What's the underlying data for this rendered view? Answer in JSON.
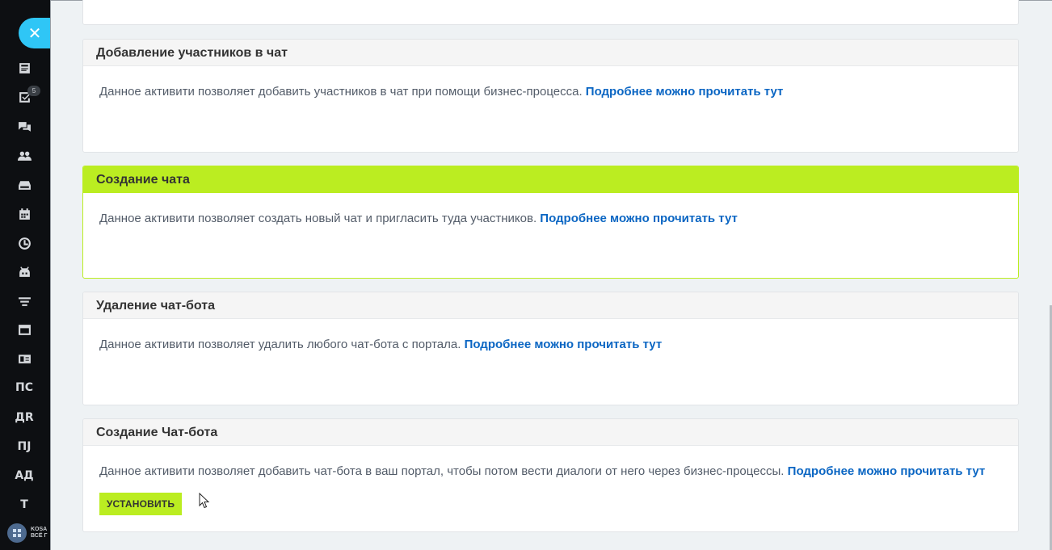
{
  "sidebar": {
    "close_icon": "✕",
    "badge_count": "5",
    "icons": [
      "feed-icon",
      "tasks-icon",
      "chat-icon",
      "users-icon",
      "drive-icon",
      "calendar-icon",
      "clock-icon",
      "robot-icon",
      "filter-icon",
      "window-icon",
      "contact-card-icon"
    ],
    "text_items": [
      "ПС",
      "ДR",
      "ПJ",
      "АД",
      "Т"
    ],
    "logo_text": "KOSA\nВСЁ Г"
  },
  "cards": [
    {
      "title": "",
      "description": "",
      "link": ""
    },
    {
      "title": "Добавление участников в чат",
      "description": "Данное активити позволяет добавить участников в чат при помощи бизнес-процесса.",
      "link": "Подробнее можно прочитать тут"
    },
    {
      "title": "Создание чата",
      "description": "Данное активити позволяет создать новый чат и пригласить туда участников.",
      "link": "Подробнее можно прочитать тут"
    },
    {
      "title": "Удаление чат-бота",
      "description": "Данное активити позволяет удалить любого чат-бота с портала.",
      "link": "Подробнее можно прочитать тут"
    },
    {
      "title": "Создание Чат-бота",
      "description": "Данное активити позволяет добавить чат-бота в ваш портал, чтобы потом вести диалоги от него через бизнес-процессы.",
      "link": "Подробнее можно прочитать тут",
      "button_label": "УСТАНОВИТЬ"
    }
  ],
  "colors": {
    "accent_green": "#bbed21",
    "link_blue": "#0b66c3",
    "sidebar_bg": "#0d0f12",
    "close_button": "#2fc6f6"
  }
}
